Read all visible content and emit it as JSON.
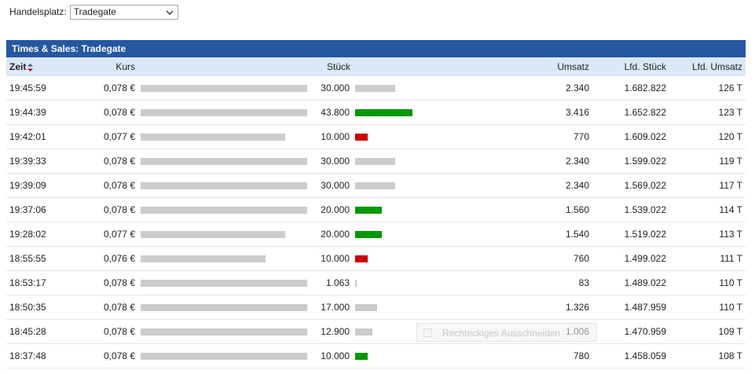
{
  "handelsplatz": {
    "label": "Handelsplatz:",
    "selected": "Tradegate"
  },
  "panel": {
    "title": "Times & Sales: Tradegate"
  },
  "columns": {
    "zeit": "Zeit",
    "kurs": "Kurs",
    "stueck": "Stück",
    "umsatz": "Umsatz",
    "lfd_stueck": "Lfd. Stück",
    "lfd_umsatz": "Lfd. Umsatz"
  },
  "colors": {
    "up": "#009900",
    "down": "#cc0000",
    "neutral": "#cccccc",
    "header": "#2557a2",
    "subheader": "#dce8f7"
  },
  "rows": [
    {
      "zeit": "19:45:59",
      "kurs": "0,078 €",
      "kurs_fill": 1.0,
      "stueck": "30.000",
      "stueck_fill": 0.7,
      "trend": "neutral",
      "umsatz": "2.340",
      "lfd_stueck": "1.682.822",
      "lfd_umsatz": "126 T"
    },
    {
      "zeit": "19:44:39",
      "kurs": "0,078 €",
      "kurs_fill": 1.0,
      "stueck": "43.800",
      "stueck_fill": 1.0,
      "trend": "up",
      "umsatz": "3.416",
      "lfd_stueck": "1.652.822",
      "lfd_umsatz": "123 T"
    },
    {
      "zeit": "19:42:01",
      "kurs": "0,077 €",
      "kurs_fill": 0.87,
      "stueck": "10.000",
      "stueck_fill": 0.22,
      "trend": "down",
      "umsatz": "770",
      "lfd_stueck": "1.609.022",
      "lfd_umsatz": "120 T"
    },
    {
      "zeit": "19:39:33",
      "kurs": "0,078 €",
      "kurs_fill": 1.0,
      "stueck": "30.000",
      "stueck_fill": 0.7,
      "trend": "neutral",
      "umsatz": "2.340",
      "lfd_stueck": "1.599.022",
      "lfd_umsatz": "119 T"
    },
    {
      "zeit": "19:39:09",
      "kurs": "0,078 €",
      "kurs_fill": 1.0,
      "stueck": "30.000",
      "stueck_fill": 0.7,
      "trend": "neutral",
      "umsatz": "2.340",
      "lfd_stueck": "1.569.022",
      "lfd_umsatz": "117 T"
    },
    {
      "zeit": "19:37:06",
      "kurs": "0,078 €",
      "kurs_fill": 1.0,
      "stueck": "20.000",
      "stueck_fill": 0.47,
      "trend": "up",
      "umsatz": "1.560",
      "lfd_stueck": "1.539.022",
      "lfd_umsatz": "114 T"
    },
    {
      "zeit": "19:28:02",
      "kurs": "0,077 €",
      "kurs_fill": 0.87,
      "stueck": "20.000",
      "stueck_fill": 0.47,
      "trend": "up",
      "umsatz": "1.540",
      "lfd_stueck": "1.519.022",
      "lfd_umsatz": "113 T"
    },
    {
      "zeit": "18:55:55",
      "kurs": "0,076 €",
      "kurs_fill": 0.75,
      "stueck": "10.000",
      "stueck_fill": 0.22,
      "trend": "down",
      "umsatz": "760",
      "lfd_stueck": "1.499.022",
      "lfd_umsatz": "111 T"
    },
    {
      "zeit": "18:53:17",
      "kurs": "0,078 €",
      "kurs_fill": 1.0,
      "stueck": "1.063",
      "stueck_fill": 0.03,
      "trend": "neutral",
      "umsatz": "83",
      "lfd_stueck": "1.489.022",
      "lfd_umsatz": "110 T"
    },
    {
      "zeit": "18:50:35",
      "kurs": "0,078 €",
      "kurs_fill": 1.0,
      "stueck": "17.000",
      "stueck_fill": 0.38,
      "trend": "neutral",
      "umsatz": "1.326",
      "lfd_stueck": "1.487.959",
      "lfd_umsatz": "110 T"
    },
    {
      "zeit": "18:45:28",
      "kurs": "0,078 €",
      "kurs_fill": 1.0,
      "stueck": "12.900",
      "stueck_fill": 0.3,
      "trend": "neutral",
      "umsatz": "1.006",
      "lfd_stueck": "1.470.959",
      "lfd_umsatz": "109 T"
    },
    {
      "zeit": "18:37:48",
      "kurs": "0,078 €",
      "kurs_fill": 1.0,
      "stueck": "10.000",
      "stueck_fill": 0.22,
      "trend": "up",
      "umsatz": "780",
      "lfd_stueck": "1.458.059",
      "lfd_umsatz": "108 T"
    }
  ],
  "overlay": {
    "label": "Rechteckiges Ausschneiden"
  }
}
